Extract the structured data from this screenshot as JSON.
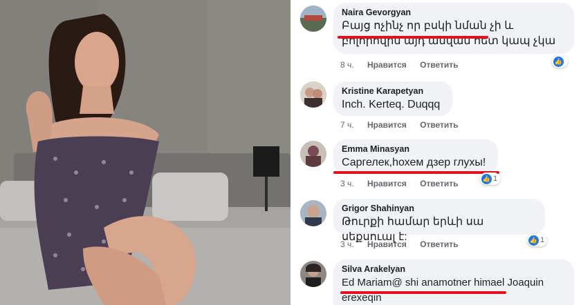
{
  "colors": {
    "bubble": "#f0f2f5",
    "underline": "#e0121b",
    "like_blue": "#1877f2",
    "meta_gray": "#65676b"
  },
  "photo": {
    "icon": "photo-of-woman-on-bed"
  },
  "comments": [
    {
      "author": "Naira Gevorgyan",
      "text": "Բայց ոչինչ որ բսկի նման չի և բոլորովին այդ անվան հետ կապ չկա",
      "time": "8 ч.",
      "like": "Нравится",
      "reply": "Ответить",
      "reactions": "",
      "underlined": true
    },
    {
      "author": "Kristine Karapetyan",
      "text": "Inch.  Kerteq. Duqqq",
      "time": "7 ч.",
      "like": "Нравится",
      "reply": "Ответить",
      "reactions": "",
      "underlined": false
    },
    {
      "author": "Emma Minasyan",
      "text": "Саргелек,hохем дзер глухы!",
      "time": "3 ч.",
      "like": "Нравится",
      "reply": "Ответить",
      "reactions": "1",
      "underlined": true
    },
    {
      "author": "Grigor Shahinyan",
      "text": "Թուրքի համար երևի սա սեքսուալ է:",
      "time": "3 ч.",
      "like": "Нравится",
      "reply": "Ответить",
      "reactions": "1",
      "underlined": false
    },
    {
      "author": "Silva Arakelyan",
      "text": "Ed Mariam@ shi anamotner himael Joaquin erexeqin",
      "time": "",
      "like": "",
      "reply": "",
      "reactions": "",
      "underlined": true
    }
  ]
}
